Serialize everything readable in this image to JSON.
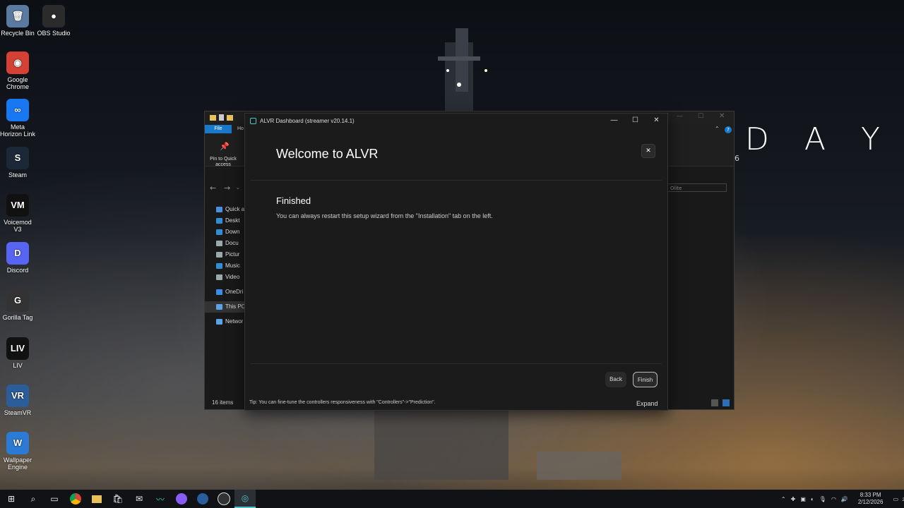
{
  "desktop": {
    "icons": [
      {
        "label": "Recycle Bin",
        "glyph": "🗑",
        "color": "#5b7aa0"
      },
      {
        "label": "OBS Studio",
        "glyph": "●",
        "color": "#2b2b2b"
      },
      {
        "label": "Google Chrome",
        "glyph": "◉",
        "color": "#d64136"
      },
      {
        "label": "Meta Horizon Link",
        "glyph": "∞",
        "color": "#1877f2"
      },
      {
        "label": "Steam",
        "glyph": "S",
        "color": "#1b2838"
      },
      {
        "label": "Voicemod V3",
        "glyph": "VM",
        "color": "#111"
      },
      {
        "label": "Discord",
        "glyph": "D",
        "color": "#5865f2"
      },
      {
        "label": "Gorilla Tag",
        "glyph": "G",
        "color": "#333"
      },
      {
        "label": "LIV",
        "glyph": "LIV",
        "color": "#111"
      },
      {
        "label": "SteamVR",
        "glyph": "VR",
        "color": "#2a5d9a"
      },
      {
        "label": "Wallpaper Engine",
        "glyph": "W",
        "color": "#2b7bd6"
      }
    ],
    "wallpaper_text": "D A Y"
  },
  "explorer": {
    "file_tab": "File",
    "home_tab": "Ho",
    "pin_label": "Pin to Quick access",
    "search_placeholder": "Olite",
    "nav_items": [
      {
        "label": "Quick a",
        "color": "#4a90e2"
      },
      {
        "label": "Deskt",
        "color": "#2d8fd5"
      },
      {
        "label": "Down",
        "color": "#2d8fd5"
      },
      {
        "label": "Docu",
        "color": "#9aa"
      },
      {
        "label": "Pictur",
        "color": "#9aa"
      },
      {
        "label": "Music",
        "color": "#2d8fd5"
      },
      {
        "label": "Video",
        "color": "#9aa"
      },
      {
        "label": "OneDri",
        "color": "#3a8ee6"
      },
      {
        "label": "This PC",
        "color": "#5aa3e6"
      },
      {
        "label": "Networ",
        "color": "#5aa3e6"
      }
    ],
    "status_count": "16 items"
  },
  "alvr": {
    "window_title": "ALVR Dashboard (streamer v20.14.1)",
    "wizard_title": "Welcome to ALVR",
    "step_title": "Finished",
    "step_desc": "You can always restart this setup wizard from the \"Installation\" tab on the left.",
    "back_label": "Back",
    "finish_label": "Finish",
    "tip": "Tip: You can fine-tune the controllers responsiveness with \"Controllers\"->\"Prediction\".",
    "expand_label": "Expand"
  },
  "taskbar": {
    "time": "8:33 PM",
    "date": "2/12/2026",
    "notifications": "2"
  }
}
